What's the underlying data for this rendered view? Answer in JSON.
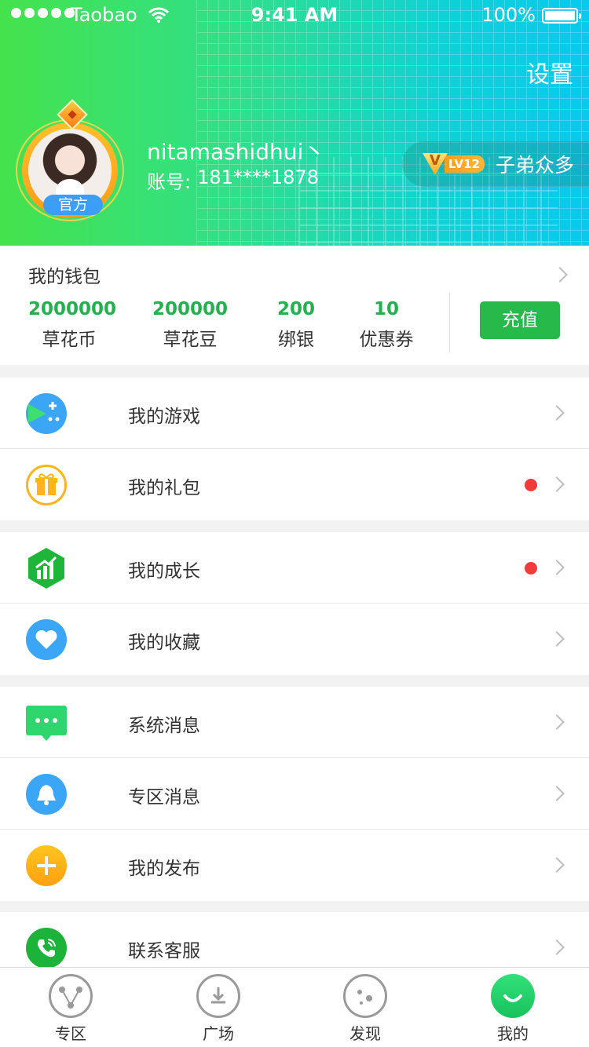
{
  "status_bar": {
    "carrier": "Taobao",
    "time": "9:41 AM",
    "battery": "100%"
  },
  "header": {
    "settings_label": "设置",
    "username": "nitamashidhui丶",
    "account_label": "账号:",
    "account_value": "181****1878",
    "official_label": "官方",
    "vip": {
      "v": "V",
      "level": "LV12",
      "title": "子弟众多"
    }
  },
  "wallet": {
    "title": "我的钱包",
    "stats": [
      {
        "value": "2000000",
        "label": "草花币"
      },
      {
        "value": "200000",
        "label": "草花豆"
      },
      {
        "value": "200",
        "label": "绑银"
      },
      {
        "value": "10",
        "label": "优惠券"
      }
    ],
    "recharge_label": "充值"
  },
  "menu": [
    {
      "label": "我的游戏",
      "icon": "game-icon",
      "dot": false
    },
    {
      "label": "我的礼包",
      "icon": "gift-icon",
      "dot": true
    },
    {
      "label": "我的成长",
      "icon": "growth-icon",
      "dot": true
    },
    {
      "label": "我的收藏",
      "icon": "heart-icon",
      "dot": false
    },
    {
      "label": "系统消息",
      "icon": "message-icon",
      "dot": false
    },
    {
      "label": "专区消息",
      "icon": "bell-icon",
      "dot": false
    },
    {
      "label": "我的发布",
      "icon": "plus-icon",
      "dot": false
    },
    {
      "label": "联系客服",
      "icon": "phone-icon",
      "dot": false
    }
  ],
  "tabs": [
    {
      "label": "专区",
      "active": false
    },
    {
      "label": "广场",
      "active": false
    },
    {
      "label": "发现",
      "active": false
    },
    {
      "label": "我的",
      "active": true
    }
  ],
  "colors": {
    "accent": "#27b94a",
    "dot": "#f23a3a",
    "header_start": "#45e24c",
    "header_end": "#08c9ee"
  }
}
